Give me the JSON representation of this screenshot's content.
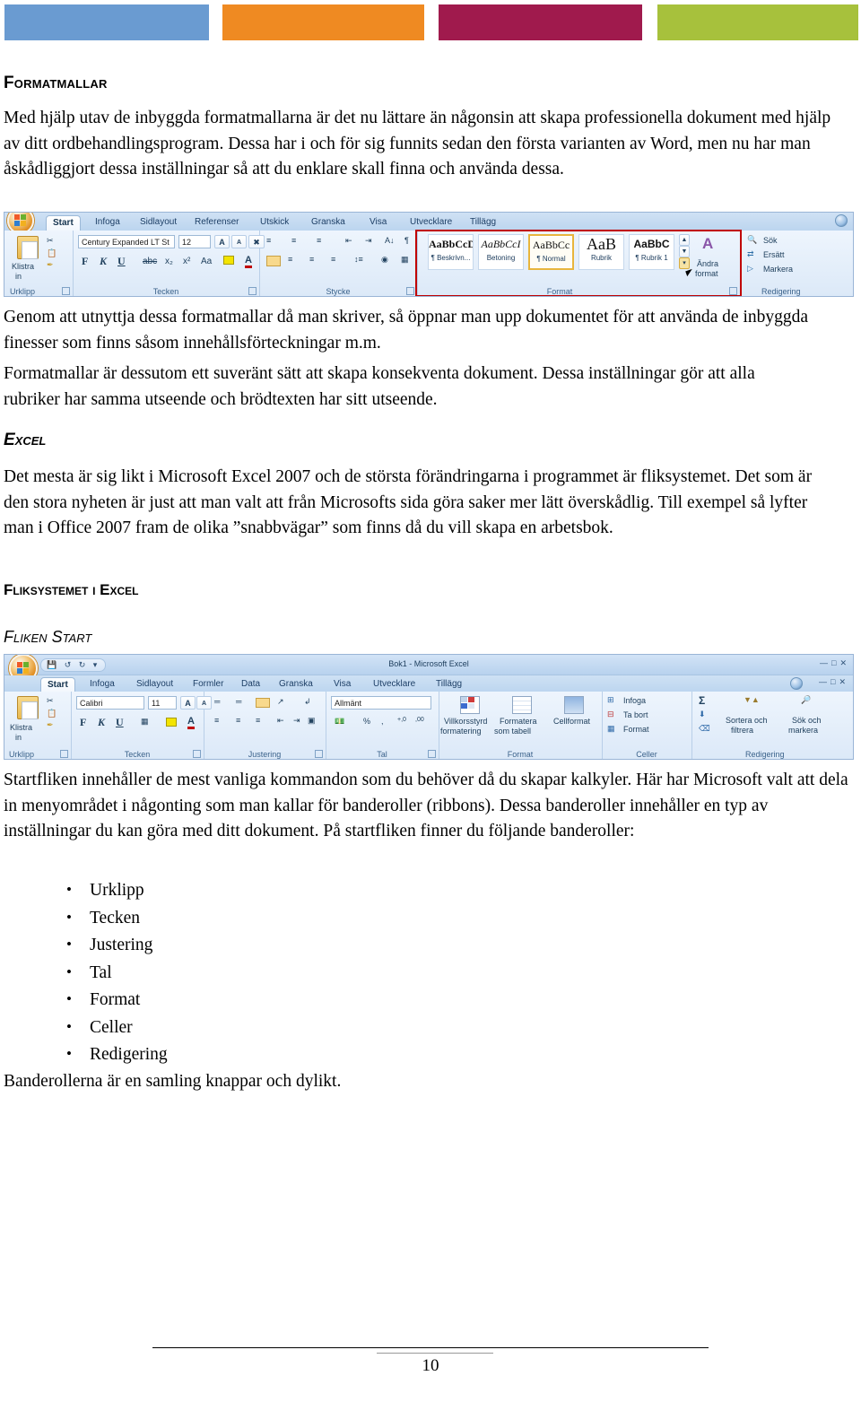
{
  "page": {
    "number": "10",
    "accent_bars": [
      {
        "name": "blue-bar",
        "color": "#6a9bd1"
      },
      {
        "name": "orange-bar",
        "color": "#ef8a22"
      },
      {
        "name": "magenta-bar",
        "color": "#a01a4d"
      },
      {
        "name": "green-bar",
        "color": "#a7c13c"
      }
    ]
  },
  "sections": {
    "formatmallar": {
      "heading": "Formatmallar",
      "paragraph1": "Med hjälp utav de inbyggda formatmallarna är det nu lättare än någonsin att skapa professionella dokument med hjälp av ditt ordbehandlingsprogram. Dessa har i och för sig funnits sedan den första varianten av Word, men nu har man åskådliggjort dessa inställningar så att du enklare skall finna och använda dessa.",
      "paragraph2": "Genom att utnyttja dessa formatmallar då man skriver, så öppnar man upp dokumentet för att använda de inbyggda finesser som finns såsom innehållsförteckningar m.m.",
      "paragraph3": "Formatmallar är dessutom ett suveränt sätt att skapa konsekventa dokument. Dessa inställningar gör att alla rubriker har samma utseende och brödtexten har sitt utseende."
    },
    "excel": {
      "heading": "Excel",
      "paragraph1": "Det mesta är sig likt i Microsoft Excel 2007 och de största förändringarna i programmet är fliksystemet. Det som är den stora nyheten är just att man valt att från Microsofts sida göra saker mer lätt överskådlig.  Till exempel så lyfter man i Office 2007 fram de olika ”snabbvägar” som finns då du vill skapa en arbetsbok."
    },
    "fliksystemet": {
      "heading": "Fliksystemet i Excel",
      "subheading": "Fliken Start",
      "paragraph1": "Startfliken innehåller de mest vanliga kommandon som du behöver då du skapar kalkyler. Här har Microsoft valt att dela in menyområdet i någonting som man kallar för banderoller (ribbons). Dessa banderoller innehåller en typ av inställningar du kan göra med ditt dokument. På startfliken finner du följande banderoller:",
      "bullets": [
        "Urklipp",
        "Tecken",
        "Justering",
        "Tal",
        "Format",
        "Celler",
        "Redigering"
      ],
      "closing": "Banderollerna är en samling knappar och dylikt."
    }
  },
  "word_ribbon": {
    "name": "word-2007-home-ribbon-screenshot",
    "tabs": [
      "Start",
      "Infoga",
      "Sidlayout",
      "Referenser",
      "Utskick",
      "Granska",
      "Visa",
      "Utvecklare",
      "Tillägg"
    ],
    "active_tab": "Start",
    "groups": [
      "Urklipp",
      "Tecken",
      "Stycke",
      "Format",
      "Redigering"
    ],
    "clipboard": {
      "paste_label_line1": "Klistra",
      "paste_label_line2": "in ",
      "icons": [
        "clipboard-icon",
        "cut-scissors-icon",
        "copy-icon",
        "format-painter-icon"
      ]
    },
    "font_group": {
      "font_name": "Century Expanded LT St",
      "font_size": "12",
      "grow_font": "A",
      "shrink_font": "A",
      "clear_formatting": "clear-format-icon",
      "bold": "F",
      "italic": "K",
      "underline": "U",
      "strikethrough": "abc",
      "subscript": "x₂",
      "superscript": "x²",
      "change_case": "Aa",
      "highlight": "highlight-icon",
      "font_color": "A"
    },
    "paragraph_group": {
      "icons": [
        "bullets-icon",
        "numbering-icon",
        "multilevel-list-icon",
        "decrease-indent-icon",
        "increase-indent-icon",
        "sort-icon",
        "show-marks-icon",
        "align-left-icon",
        "align-center-icon",
        "align-right-icon",
        "justify-icon",
        "line-spacing-icon",
        "shading-icon",
        "borders-icon"
      ]
    },
    "styles": [
      {
        "preview": "AaBbCcDc",
        "name": "¶ Beskrivn...",
        "selected": false
      },
      {
        "preview": "AaBbCcI",
        "name": "Betoning",
        "selected": false
      },
      {
        "preview": "AaBbCc",
        "name": "¶ Normal",
        "selected": true
      },
      {
        "preview": "AaB",
        "name": "Rubrik",
        "selected": false
      },
      {
        "preview": "AaBbC",
        "name": "¶ Rubrik 1",
        "selected": false
      }
    ],
    "change_styles": {
      "label_line1": "Ändra",
      "label_line2": "format "
    },
    "editing": {
      "find": "Sök ",
      "replace": "Ersätt",
      "select": "Markera "
    },
    "highlight_color": "#c00000"
  },
  "excel_ribbon": {
    "name": "excel-2007-home-ribbon-screenshot",
    "title": "Bok1 - Microsoft Excel",
    "window_controls": [
      "minimize",
      "restore",
      "close"
    ],
    "tabs": [
      "Start",
      "Infoga",
      "Sidlayout",
      "Formler",
      "Data",
      "Granska",
      "Visa",
      "Utvecklare",
      "Tillägg"
    ],
    "active_tab": "Start",
    "groups": [
      "Urklipp",
      "Tecken",
      "Justering",
      "Tal",
      "Format",
      "Celler",
      "Redigering"
    ],
    "clipboard": {
      "paste_label_line1": "Klistra",
      "paste_label_line2": "in "
    },
    "font_group": {
      "font_name": "Calibri",
      "font_size": "11",
      "bold": "F",
      "italic": "K",
      "underline": "U"
    },
    "number_group": {
      "format": "Allmänt",
      "percent": "%",
      "comma": ",",
      "inc_dec": "+,0",
      "dec_dec": ",00"
    },
    "format_group": [
      {
        "label_line1": "Villkorsstyrd",
        "label_line2": "formatering "
      },
      {
        "label_line1": "Formatera",
        "label_line2": "som tabell "
      },
      {
        "label_line1": "Cellformat",
        "label_line2": " "
      }
    ],
    "cells_group": [
      {
        "label": "Infoga "
      },
      {
        "label": "Ta bort "
      },
      {
        "label": "Format "
      }
    ],
    "editing_group": [
      {
        "label_line1": "Sortera och",
        "label_line2": "filtrera "
      },
      {
        "label_line1": "Sök och",
        "label_line2": "markera "
      }
    ],
    "editing_icons": [
      "autosum-icon",
      "fill-icon",
      "clear-icon"
    ]
  }
}
